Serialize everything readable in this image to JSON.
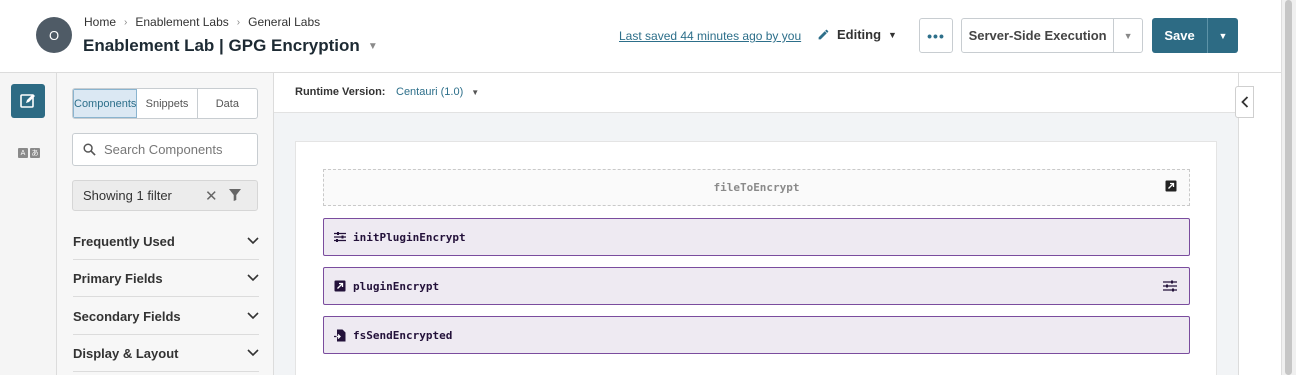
{
  "header": {
    "avatar_initial": "O",
    "breadcrumb": [
      "Home",
      "Enablement Labs",
      "General Labs"
    ],
    "title": "Enablement Lab | GPG Encryption",
    "last_saved": "Last saved 44 minutes ago by you",
    "mode": "Editing",
    "more_label": "•••",
    "execution": "Server-Side Execution",
    "save": "Save"
  },
  "panel": {
    "tabs": [
      "Components",
      "Snippets",
      "Data"
    ],
    "active_tab": "Components",
    "search_placeholder": "Search Components",
    "filter_label": "Showing 1 filter",
    "sections": [
      "Frequently Used",
      "Primary Fields",
      "Secondary Fields",
      "Display & Layout"
    ]
  },
  "canvas": {
    "runtime_label": "Runtime Version:",
    "runtime_value": "Centauri (1.0)",
    "components": [
      {
        "name": "fileToEncrypt",
        "kind": "hidden"
      },
      {
        "name": "initPluginEncrypt",
        "kind": "plugin-init"
      },
      {
        "name": "pluginEncrypt",
        "kind": "plugin"
      },
      {
        "name": "fsSendEncrypted",
        "kind": "file-send"
      }
    ]
  },
  "colors": {
    "accent": "#2d6b84",
    "component_border": "#7a4c9e",
    "component_fill": "#eeeaf2"
  }
}
